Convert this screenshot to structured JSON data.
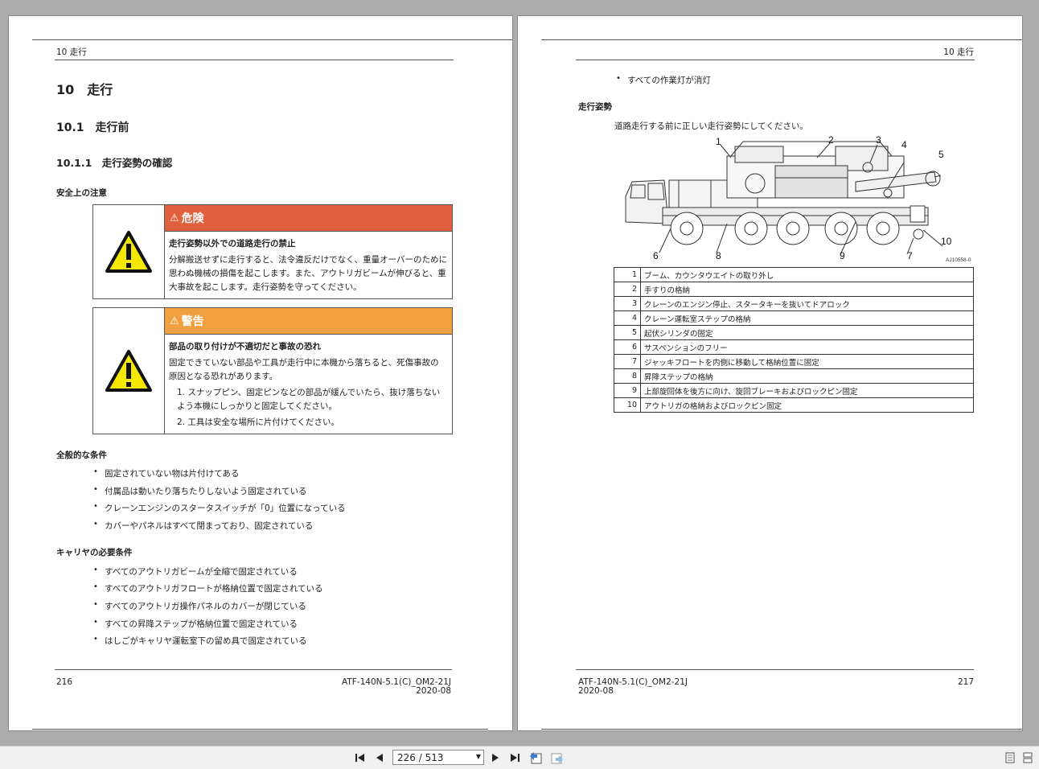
{
  "left_page": {
    "header": "10 走行",
    "h1": "10　走行",
    "h2": "10.1　走行前",
    "h3": "10.1.1　走行姿勢の確認",
    "safety_heading": "安全上の注意",
    "danger": {
      "label": "危険",
      "color": "#e0603e",
      "title": "走行姿勢以外での道路走行の禁止",
      "text": "分解搬送せずに走行すると、法令違反だけでなく、重量オーバーのために思わぬ機械の損傷を起こします。また、アウトリガビームが伸びると、重大事故を起こします。走行姿勢を守ってください。"
    },
    "warning": {
      "label": "警告",
      "color": "#f0a040",
      "title": "部品の取り付けが不適切だと事故の恐れ",
      "text": "固定できていない部品や工具が走行中に本機から落ちると、死傷事故の原因となる恐れがあります。",
      "items": [
        "1. スナップピン、固定ピンなどの部品が緩んでいたら、抜け落ちないよう本機にしっかりと固定してください。",
        "2. 工具は安全な場所に片付けてください。"
      ]
    },
    "general_heading": "全般的な条件",
    "general_items": [
      "固定されていない物は片付けてある",
      "付属品は動いたり落ちたりしないよう固定されている",
      "クレーンエンジンのスタータスイッチが「0」位置になっている",
      "カバーやパネルはすべて閉まっており、固定されている"
    ],
    "carrier_heading": "キャリヤの必要条件",
    "carrier_items": [
      "すべてのアウトリガビームが全縮で固定されている",
      "すべてのアウトリガフロートが格納位置で固定されている",
      "すべてのアウトリガ操作パネルのカバーが閉じている",
      "すべての昇降ステップが格納位置で固定されている",
      "はしごがキャリヤ運転室下の留め具で固定されている"
    ],
    "page_number": "216",
    "doc_id": "ATF-140N-5.1(C)_OM2-21J",
    "date": "2020-08"
  },
  "right_page": {
    "header": "10 走行",
    "bullet_top": "すべての作業灯が消灯",
    "travel_heading": "走行姿勢",
    "travel_text": "道路走行する前に正しい走行姿勢にしてください。",
    "figure_id": "AJ10558-0",
    "callouts": [
      "1",
      "2",
      "3",
      "4",
      "5",
      "6",
      "7",
      "8",
      "9",
      "10"
    ],
    "parts": [
      {
        "num": "1",
        "text": "ブーム、カウンタウエイトの取り外し"
      },
      {
        "num": "2",
        "text": "手すりの格納"
      },
      {
        "num": "3",
        "text": "クレーンのエンジン停止、スタータキーを抜いてドアロック"
      },
      {
        "num": "4",
        "text": "クレーン運転室ステップの格納"
      },
      {
        "num": "5",
        "text": "起伏シリンダの固定"
      },
      {
        "num": "6",
        "text": "サスペンションのフリー"
      },
      {
        "num": "7",
        "text": "ジャッキフロートを内側に移動して格納位置に固定"
      },
      {
        "num": "8",
        "text": "昇降ステップの格納"
      },
      {
        "num": "9",
        "text": "上部旋回体を後方に向け、旋回ブレーキおよびロックピン固定"
      },
      {
        "num": "10",
        "text": "アウトリガの格納およびロックピン固定"
      }
    ],
    "page_number": "217",
    "doc_id": "ATF-140N-5.1(C)_OM2-21J",
    "date": "2020-08"
  },
  "toolbar": {
    "page_indicator": "226 / 513"
  }
}
